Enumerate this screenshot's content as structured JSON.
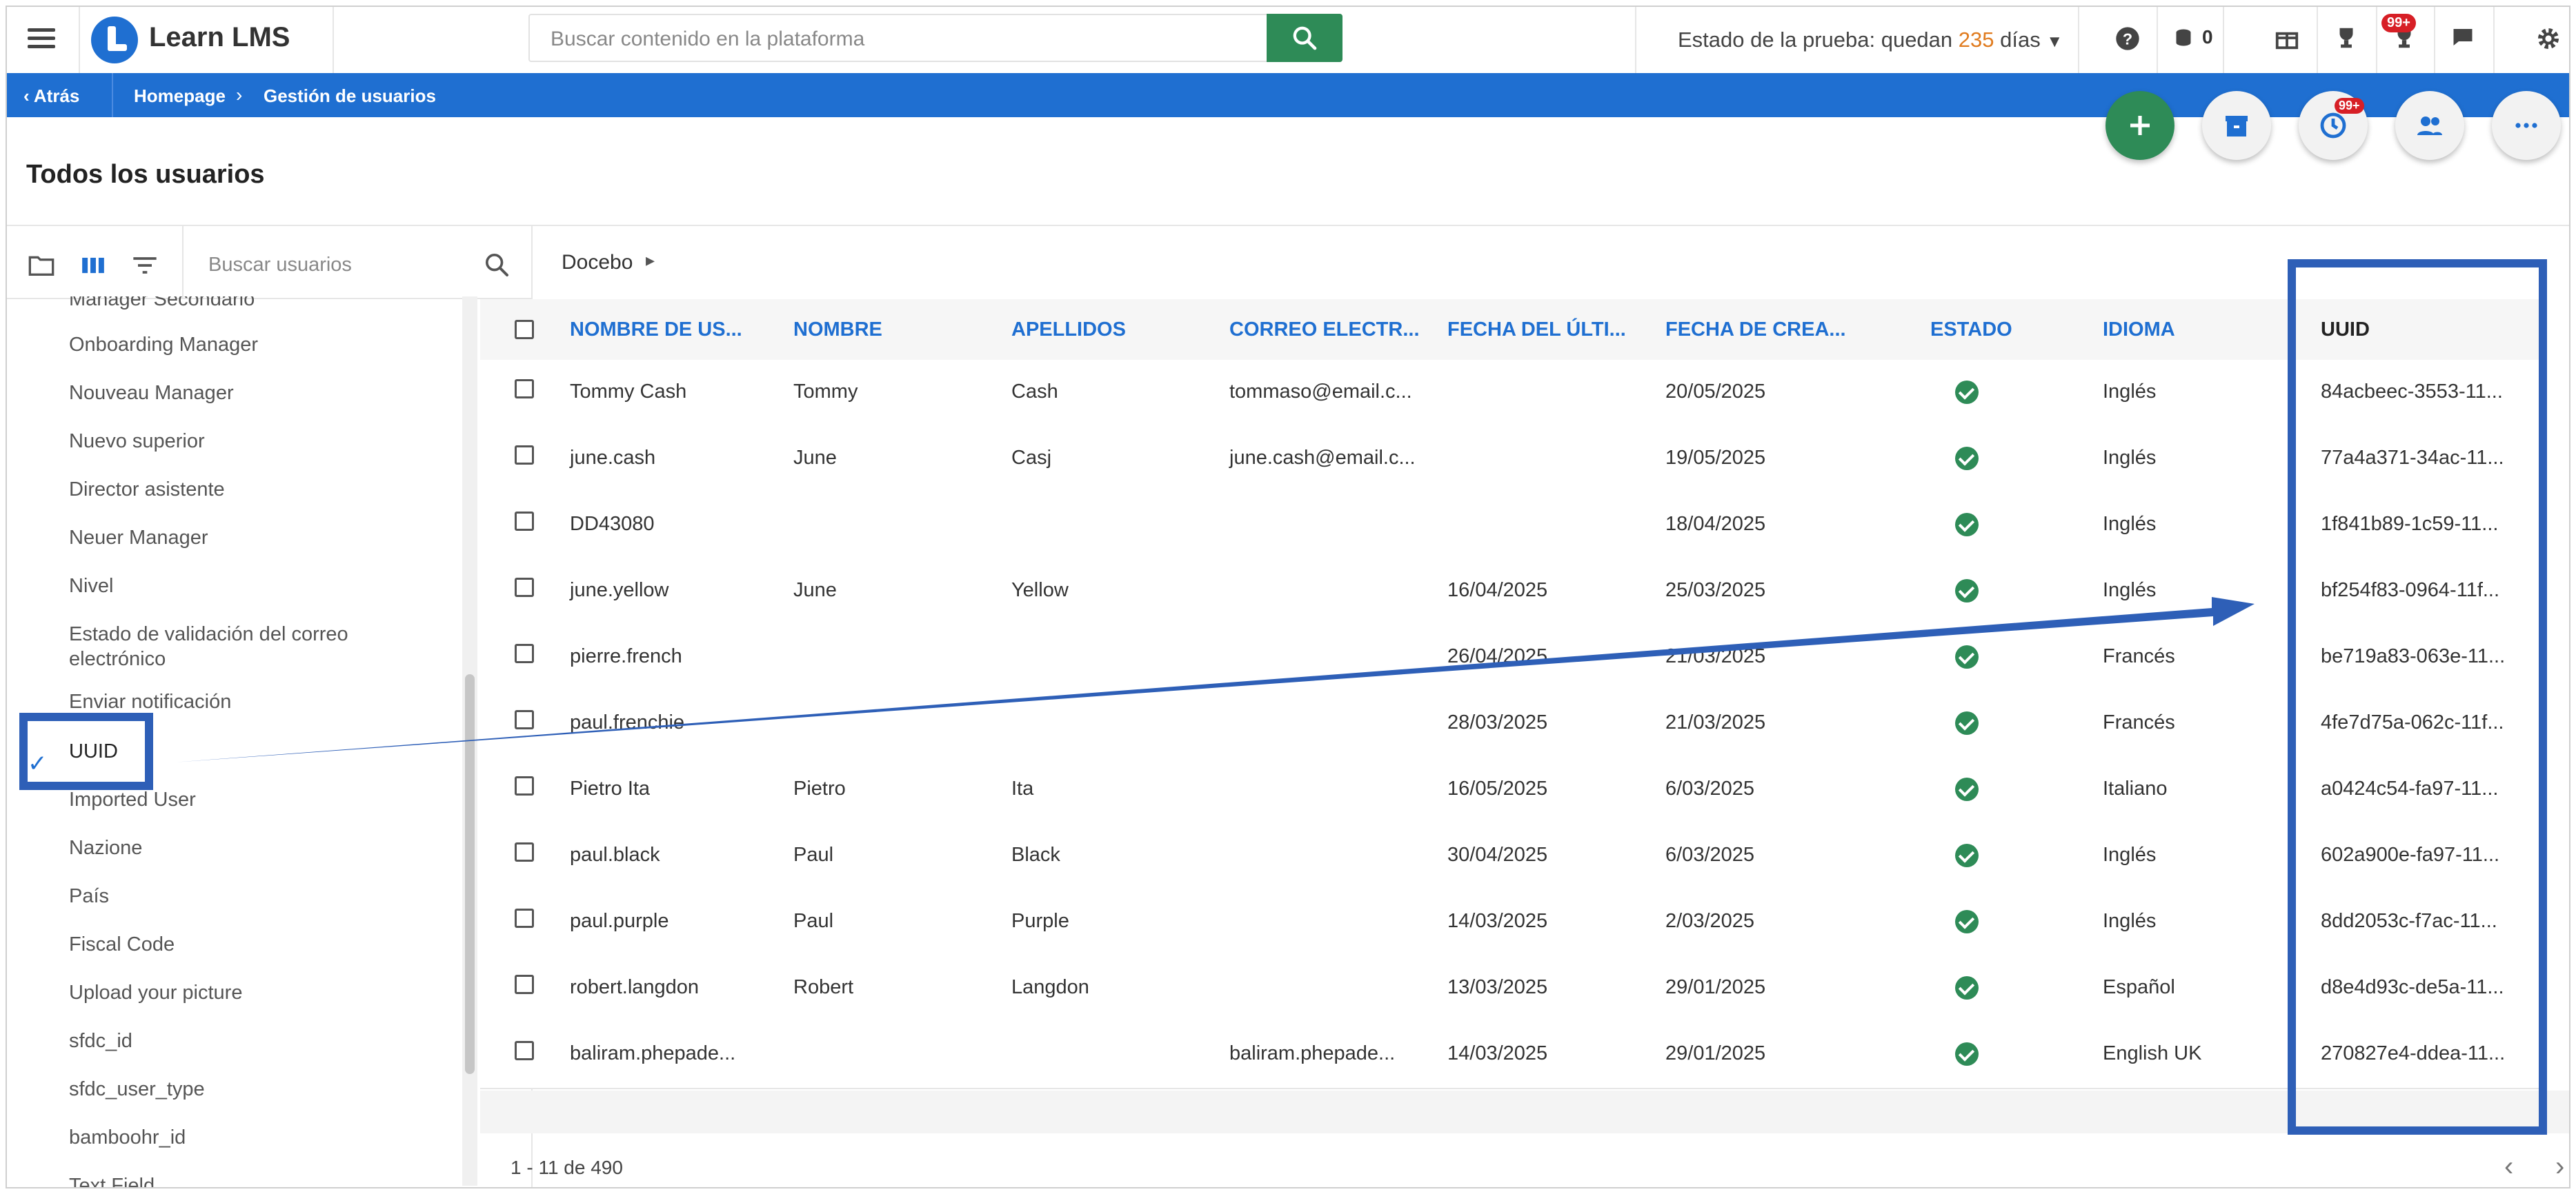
{
  "header": {
    "brand": "Learn LMS",
    "search_placeholder": "Buscar contenido en la plataforma",
    "trial_prefix": "Estado de la prueba: quedan ",
    "trial_days": "235",
    "trial_suffix": " días",
    "credits": "0",
    "notifications_badge": "99+"
  },
  "breadcrumb": {
    "back": "Atrás",
    "home": "Homepage",
    "current": "Gestión de usuarios"
  },
  "actions": {
    "history_badge": "99+"
  },
  "page": {
    "title": "Todos los usuarios"
  },
  "left_panel": {
    "search_placeholder": "Buscar usuarios",
    "fields": [
      "Manager Secondario",
      "Onboarding Manager",
      "Nouveau Manager",
      "Nuevo superior",
      "Director asistente",
      "Neuer Manager",
      "Nivel",
      "Estado de validación del correo electrónico",
      "Enviar notificación",
      "UUID",
      "Imported User",
      "Nazione",
      "País",
      "Fiscal Code",
      "Upload your picture",
      "sfdc_id",
      "sfdc_user_type",
      "bamboohr_id",
      "Text Field"
    ],
    "checked_field": "UUID"
  },
  "content": {
    "path": "Docebo",
    "columns": [
      "NOMBRE DE US...",
      "NOMBRE",
      "APELLIDOS",
      "CORREO ELECTR...",
      "FECHA DEL ÚLTI...",
      "FECHA DE CREA...",
      "ESTADO",
      "IDIOMA",
      "UUID"
    ],
    "rows": [
      {
        "username": "Tommy Cash",
        "first": "Tommy",
        "last": "Cash",
        "email": "tommaso@email.c...",
        "last_login": "",
        "created": "20/05/2025",
        "language": "Inglés",
        "uuid": "84acbeec-3553-11..."
      },
      {
        "username": "june.cash",
        "first": "June",
        "last": "Casj",
        "email": "june.cash@email.c...",
        "last_login": "",
        "created": "19/05/2025",
        "language": "Inglés",
        "uuid": "77a4a371-34ac-11..."
      },
      {
        "username": "DD43080",
        "first": "",
        "last": "",
        "email": "",
        "last_login": "",
        "created": "18/04/2025",
        "language": "Inglés",
        "uuid": "1f841b89-1c59-11..."
      },
      {
        "username": "june.yellow",
        "first": "June",
        "last": "Yellow",
        "email": "",
        "last_login": "16/04/2025",
        "created": "25/03/2025",
        "language": "Inglés",
        "uuid": "bf254f83-0964-11f..."
      },
      {
        "username": "pierre.french",
        "first": "",
        "last": "",
        "email": "",
        "last_login": "26/04/2025",
        "created": "21/03/2025",
        "language": "Francés",
        "uuid": "be719a83-063e-11..."
      },
      {
        "username": "paul.frenchie",
        "first": "",
        "last": "",
        "email": "",
        "last_login": "28/03/2025",
        "created": "21/03/2025",
        "language": "Francés",
        "uuid": "4fe7d75a-062c-11f..."
      },
      {
        "username": "Pietro Ita",
        "first": "Pietro",
        "last": "Ita",
        "email": "",
        "last_login": "16/05/2025",
        "created": "6/03/2025",
        "language": "Italiano",
        "uuid": "a0424c54-fa97-11..."
      },
      {
        "username": "paul.black",
        "first": "Paul",
        "last": "Black",
        "email": "",
        "last_login": "30/04/2025",
        "created": "6/03/2025",
        "language": "Inglés",
        "uuid": "602a900e-fa97-11..."
      },
      {
        "username": "paul.purple",
        "first": "Paul",
        "last": "Purple",
        "email": "",
        "last_login": "14/03/2025",
        "created": "2/03/2025",
        "language": "Inglés",
        "uuid": "8dd2053c-f7ac-11..."
      },
      {
        "username": "robert.langdon",
        "first": "Robert",
        "last": "Langdon",
        "email": "",
        "last_login": "13/03/2025",
        "created": "29/01/2025",
        "language": "Español",
        "uuid": "d8e4d93c-de5a-11..."
      },
      {
        "username": "baliram.phepade...",
        "first": "",
        "last": "",
        "email": "baliram.phepade...",
        "last_login": "14/03/2025",
        "created": "29/01/2025",
        "language": "English UK",
        "uuid": "270827e4-ddea-11..."
      }
    ],
    "pager": "1 - 11 de 490"
  },
  "colors": {
    "brand_blue": "#1f6fd1",
    "success_green": "#2e8b57",
    "annotation_blue": "#2e5fb7",
    "trial_orange": "#e07b1e"
  }
}
